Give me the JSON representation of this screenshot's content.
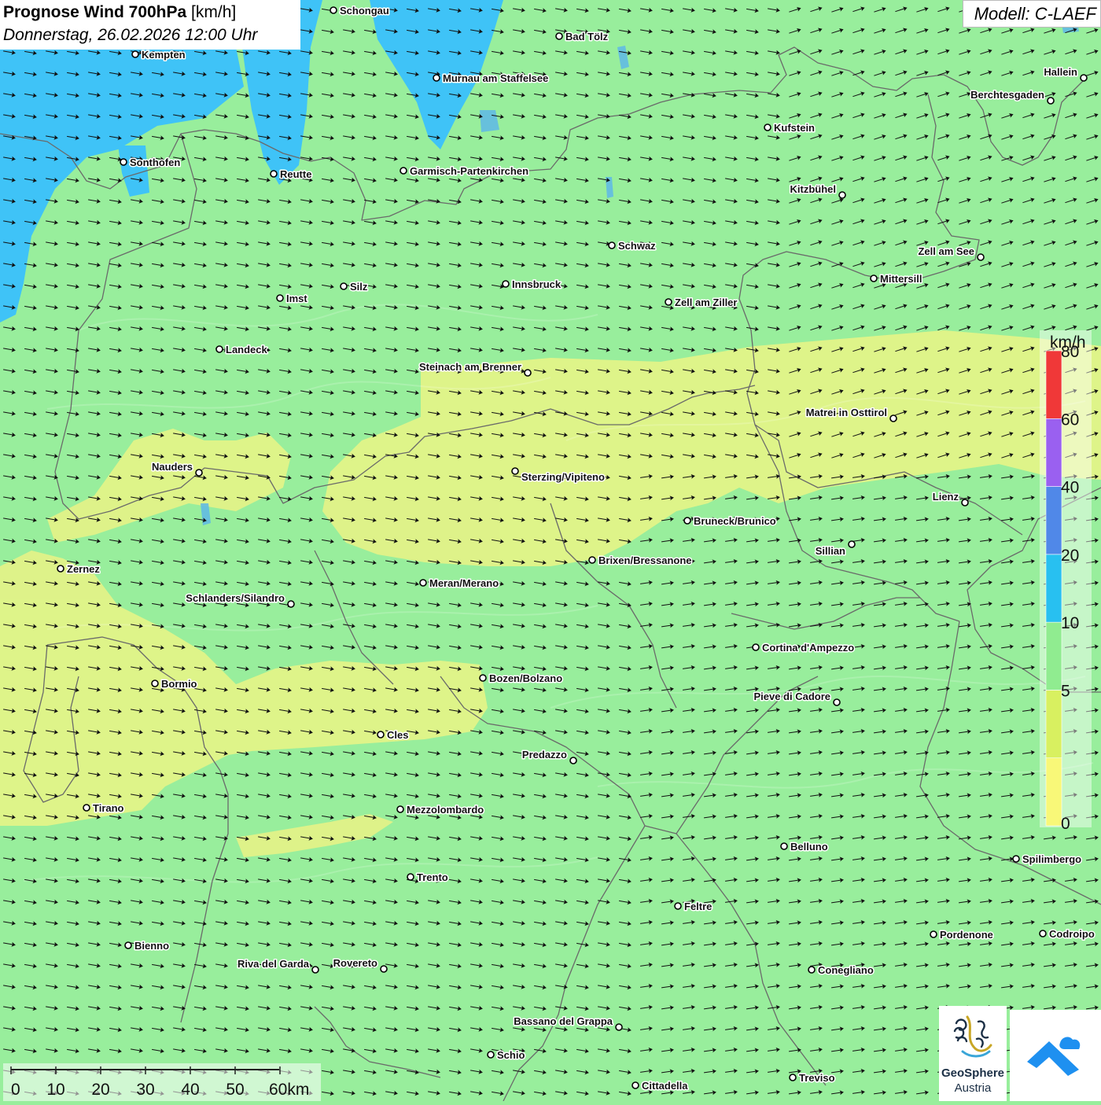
{
  "header": {
    "title_bold": "Prognose Wind 700hPa",
    "title_unit": " [km/h]",
    "subtitle": "Donnerstag, 26.02.2026 12:00 Uhr"
  },
  "model": {
    "label": "Modell: C-LAEF"
  },
  "legend": {
    "unit": "km/h",
    "ticks": [
      {
        "value": "0",
        "level": 0
      },
      {
        "value": "5",
        "level": 1
      },
      {
        "value": "10",
        "level": 2
      },
      {
        "value": "20",
        "level": 3
      },
      {
        "value": "40",
        "level": 4
      },
      {
        "value": "60",
        "level": 5
      },
      {
        "value": "80",
        "level": 6
      }
    ],
    "colors": [
      "#f8f878",
      "#d8f060",
      "#90ec90",
      "#28c0f0",
      "#5088e8",
      "#9a60f0",
      "#f03838"
    ]
  },
  "scale_bar": {
    "labels": [
      "0",
      "10",
      "20",
      "30",
      "40",
      "50",
      "60km"
    ]
  },
  "colors": {
    "field_green": "#98ee9c",
    "field_yellow": "#e2f388",
    "field_blue": "#3fc3f7",
    "border": "#6a6a6a"
  },
  "cities": [
    {
      "name": "Schongau"
    },
    {
      "name": "Bad Tölz"
    },
    {
      "name": "Kempten"
    },
    {
      "name": "Murnau am Staffelsee"
    },
    {
      "name": "Hallein"
    },
    {
      "name": "Berchtesgaden"
    },
    {
      "name": "Kufstein"
    },
    {
      "name": "Sonthofen"
    },
    {
      "name": "Reutte"
    },
    {
      "name": "Garmisch-Partenkirchen"
    },
    {
      "name": "Kitzbühel"
    },
    {
      "name": "Schwaz"
    },
    {
      "name": "Zell am See"
    },
    {
      "name": "Mittersill"
    },
    {
      "name": "Innsbruck"
    },
    {
      "name": "Silz"
    },
    {
      "name": "Imst"
    },
    {
      "name": "Zell am Ziller"
    },
    {
      "name": "Landeck"
    },
    {
      "name": "Steinach am Brenner"
    },
    {
      "name": "Matrei in Osttirol"
    },
    {
      "name": "Nauders"
    },
    {
      "name": "Sterzing/Vipiteno"
    },
    {
      "name": "Lienz"
    },
    {
      "name": "Bruneck/Brunico"
    },
    {
      "name": "Sillian"
    },
    {
      "name": "Brixen/Bressanone"
    },
    {
      "name": "Zernez"
    },
    {
      "name": "Meran/Merano"
    },
    {
      "name": "Schlanders/Silandro"
    },
    {
      "name": "Cortina d'Ampezzo"
    },
    {
      "name": "Bozen/Bolzano"
    },
    {
      "name": "Bormio"
    },
    {
      "name": "Pieve di Cadore"
    },
    {
      "name": "Cles"
    },
    {
      "name": "Predazzo"
    },
    {
      "name": "Tirano"
    },
    {
      "name": "Mezzolombardo"
    },
    {
      "name": "Belluno"
    },
    {
      "name": "Spilimbergo"
    },
    {
      "name": "Trento"
    },
    {
      "name": "Feltre"
    },
    {
      "name": "Pordenone"
    },
    {
      "name": "Codroipo"
    },
    {
      "name": "Bienno"
    },
    {
      "name": "Riva del Garda"
    },
    {
      "name": "Rovereto"
    },
    {
      "name": "Conegliano"
    },
    {
      "name": "Bassano del Grappa"
    },
    {
      "name": "Schio"
    },
    {
      "name": "Treviso"
    },
    {
      "name": "Cittadella"
    }
  ],
  "logos": {
    "geosphere_line1": "GeoSphere",
    "geosphere_line2": "Austria"
  }
}
